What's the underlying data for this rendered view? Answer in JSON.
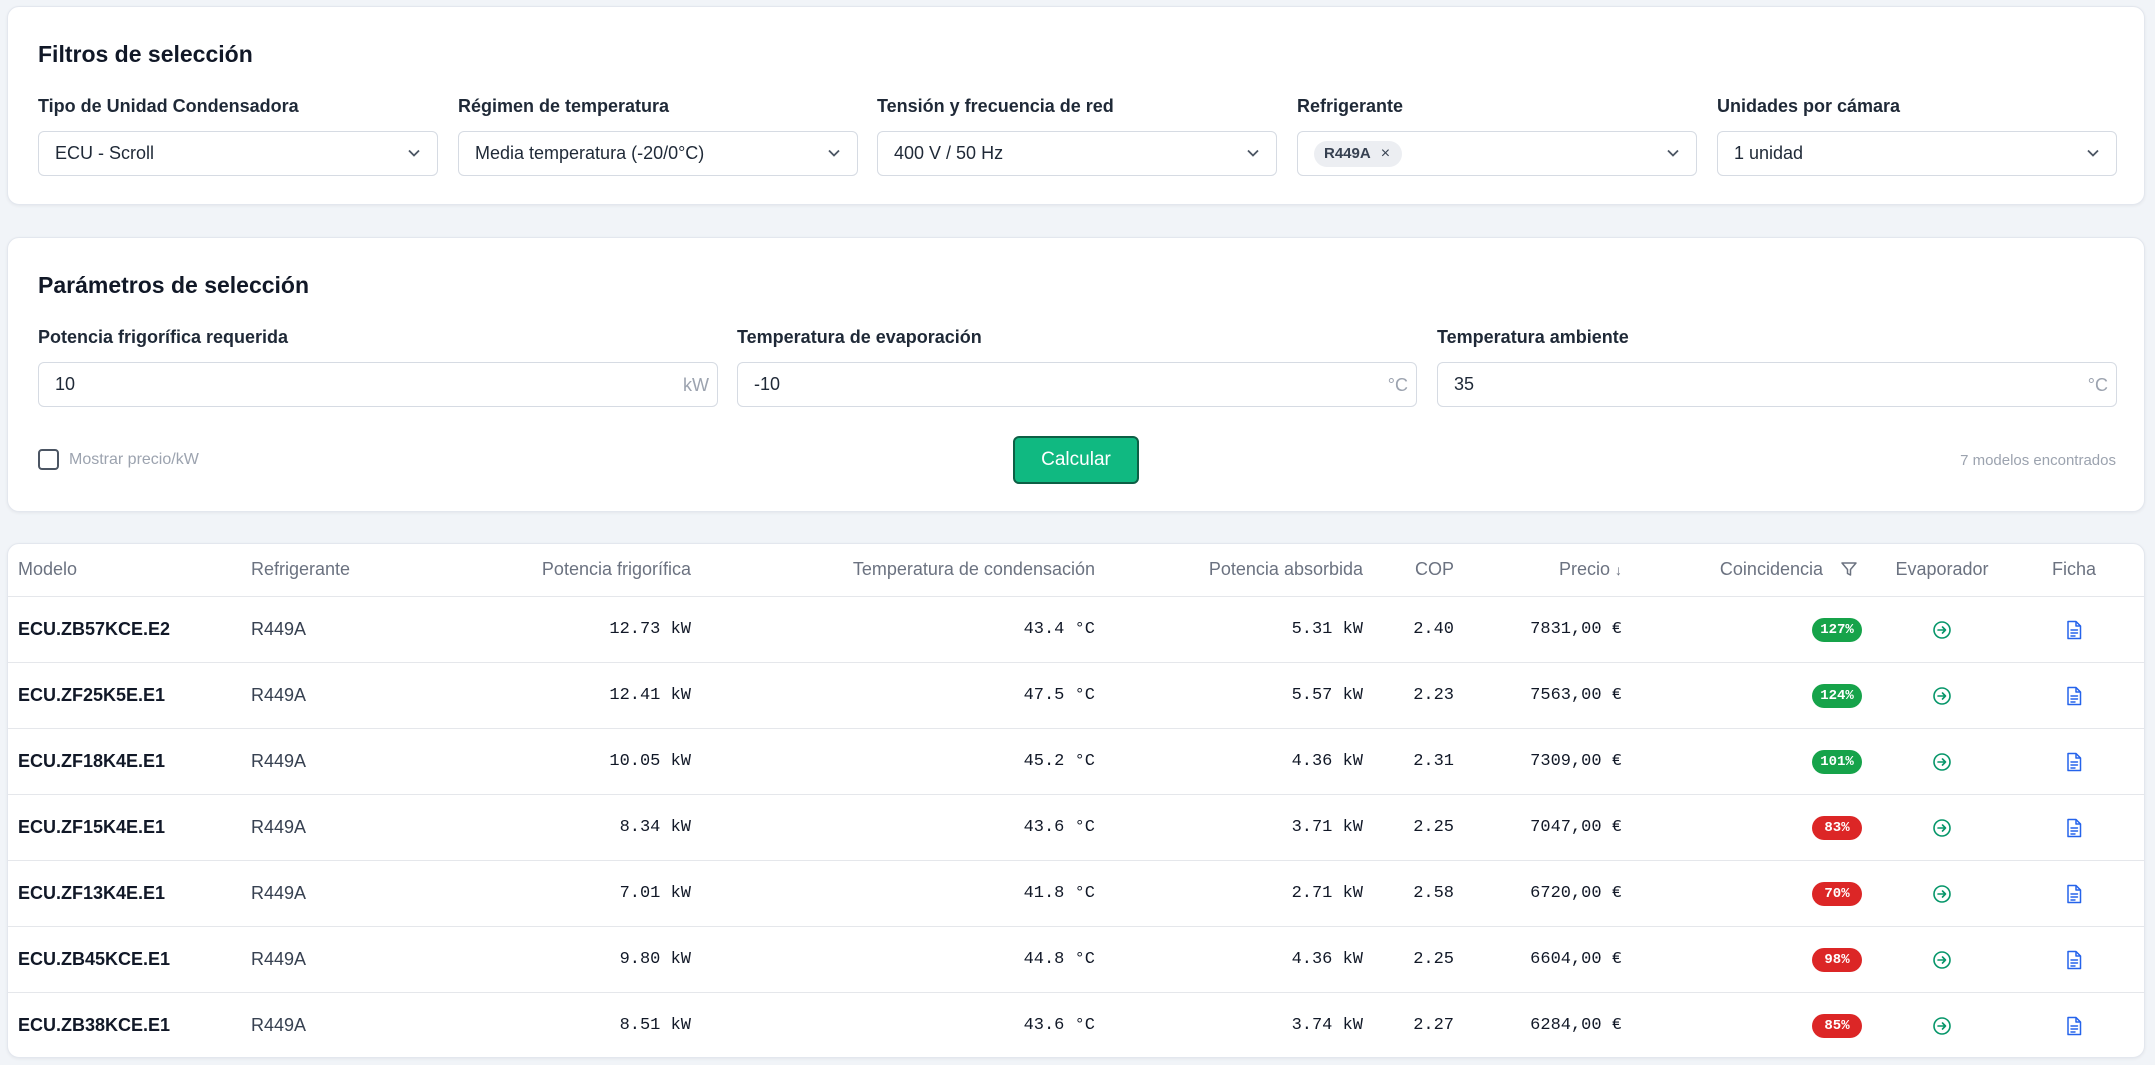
{
  "filters": {
    "title": "Filtros de selección",
    "fields": [
      {
        "label": "Tipo de Unidad Condensadora",
        "value": "ECU - Scroll"
      },
      {
        "label": "Régimen de temperatura",
        "value": "Media temperatura (-20/0°C)"
      },
      {
        "label": "Tensión y frecuencia de red",
        "value": "400 V / 50 Hz"
      },
      {
        "label": "Refrigerante",
        "value": "R449A",
        "chip_remove": "×"
      },
      {
        "label": "Unidades por cámara",
        "value": "1 unidad"
      }
    ]
  },
  "params": {
    "title": "Parámetros de selección",
    "fields": [
      {
        "label": "Potencia frigorífica requerida",
        "value": "10",
        "unit": "kW"
      },
      {
        "label": "Temperatura de evaporación",
        "value": "-10",
        "unit": "°C"
      },
      {
        "label": "Temperatura ambiente",
        "value": "35",
        "unit": "°C"
      }
    ],
    "show_price_label": "Mostrar precio/kW",
    "calculate_label": "Calcular",
    "found_text": "7 modelos encontrados"
  },
  "table": {
    "headers": {
      "model": "Modelo",
      "refrigerant": "Refrigerante",
      "capacity": "Potencia frigorífica",
      "cond_temp": "Temperatura de condensación",
      "power": "Potencia absorbida",
      "cop": "COP",
      "price": "Precio",
      "price_sort": "↓",
      "match": "Coincidencia",
      "evaporator": "Evaporador",
      "sheet": "Ficha"
    },
    "rows": [
      {
        "model": "ECU.ZB57KCE.E2",
        "refrigerant": "R449A",
        "capacity": "12.73 kW",
        "cond_temp": "43.4 °C",
        "power": "5.31 kW",
        "cop": "2.40",
        "price": "7831,00 €",
        "match": "127%",
        "match_status": "ok"
      },
      {
        "model": "ECU.ZF25K5E.E1",
        "refrigerant": "R449A",
        "capacity": "12.41 kW",
        "cond_temp": "47.5 °C",
        "power": "5.57 kW",
        "cop": "2.23",
        "price": "7563,00 €",
        "match": "124%",
        "match_status": "ok"
      },
      {
        "model": "ECU.ZF18K4E.E1",
        "refrigerant": "R449A",
        "capacity": "10.05 kW",
        "cond_temp": "45.2 °C",
        "power": "4.36 kW",
        "cop": "2.31",
        "price": "7309,00 €",
        "match": "101%",
        "match_status": "ok"
      },
      {
        "model": "ECU.ZF15K4E.E1",
        "refrigerant": "R449A",
        "capacity": "8.34 kW",
        "cond_temp": "43.6 °C",
        "power": "3.71 kW",
        "cop": "2.25",
        "price": "7047,00 €",
        "match": "83%",
        "match_status": "low"
      },
      {
        "model": "ECU.ZF13K4E.E1",
        "refrigerant": "R449A",
        "capacity": "7.01 kW",
        "cond_temp": "41.8 °C",
        "power": "2.71 kW",
        "cop": "2.58",
        "price": "6720,00 €",
        "match": "70%",
        "match_status": "low"
      },
      {
        "model": "ECU.ZB45KCE.E1",
        "refrigerant": "R449A",
        "capacity": "9.80 kW",
        "cond_temp": "44.8 °C",
        "power": "4.36 kW",
        "cop": "2.25",
        "price": "6604,00 €",
        "match": "98%",
        "match_status": "low"
      },
      {
        "model": "ECU.ZB38KCE.E1",
        "refrigerant": "R449A",
        "capacity": "8.51 kW",
        "cond_temp": "43.6 °C",
        "power": "3.74 kW",
        "cop": "2.27",
        "price": "6284,00 €",
        "match": "85%",
        "match_status": "low"
      }
    ]
  },
  "colors": {
    "ok": "#16a34a",
    "low": "#dc2626",
    "primary": "#10b981",
    "evaporator_icon": "#059669",
    "sheet_icon": "#2563eb"
  },
  "icons": {
    "select_chevron": "chevron-down-icon",
    "match_filter": "filter-icon",
    "evaporator": "arrow-right-circle-icon",
    "sheet": "document-icon"
  }
}
